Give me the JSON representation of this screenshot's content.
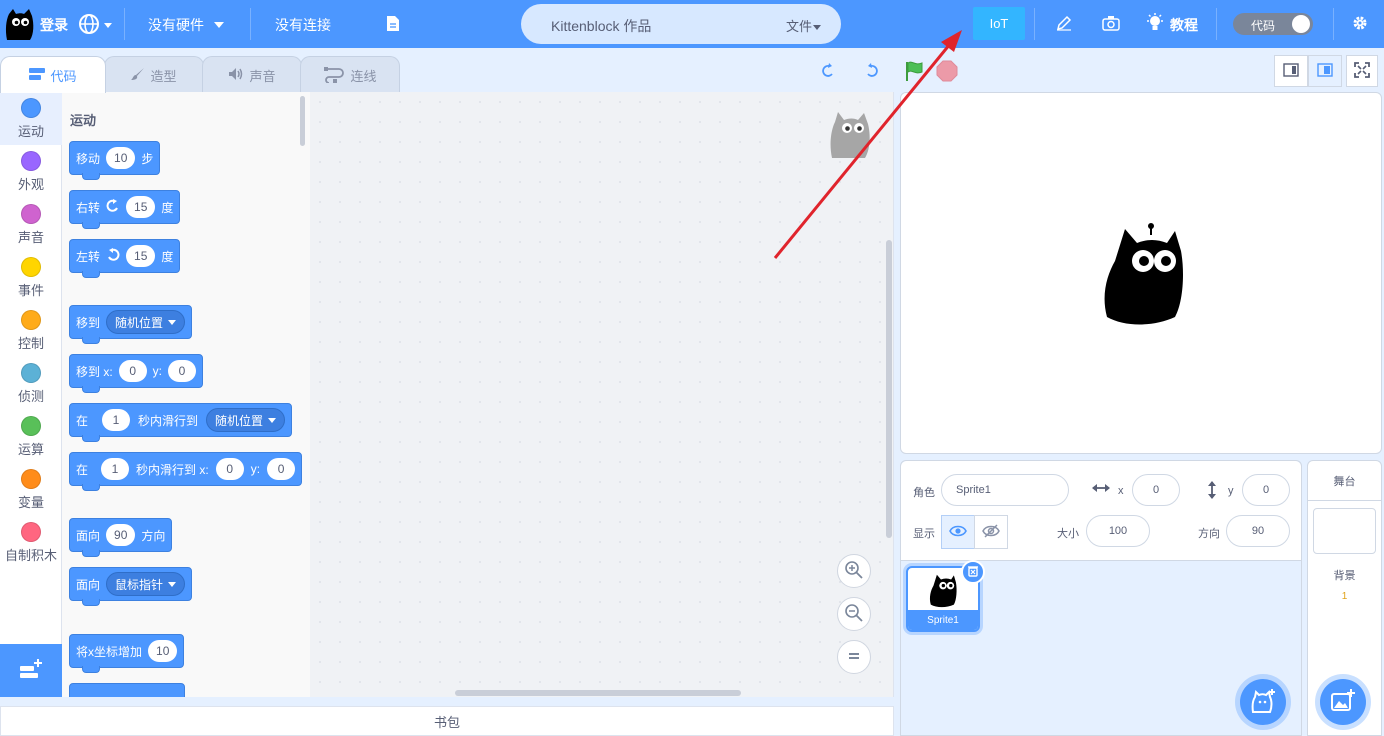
{
  "topbar": {
    "login": "登录",
    "hardware": "没有硬件",
    "connection": "没有连接",
    "project_title": "Kittenblock 作品",
    "file_menu": "文件",
    "iot": "IoT",
    "tutorial": "教程",
    "code_toggle": "代码"
  },
  "tabs": [
    {
      "label": "代码"
    },
    {
      "label": "造型"
    },
    {
      "label": "声音"
    },
    {
      "label": "连线"
    }
  ],
  "categories": [
    {
      "label": "运动",
      "color": "#4c97ff"
    },
    {
      "label": "外观",
      "color": "#9966ff"
    },
    {
      "label": "声音",
      "color": "#cf63cf"
    },
    {
      "label": "事件",
      "color": "#ffd500"
    },
    {
      "label": "控制",
      "color": "#ffab19"
    },
    {
      "label": "侦测",
      "color": "#5cb1d6"
    },
    {
      "label": "运算",
      "color": "#59c059"
    },
    {
      "label": "变量",
      "color": "#ff8c1a"
    },
    {
      "label": "自制积木",
      "color": "#ff6680"
    }
  ],
  "palette": {
    "title": "运动",
    "move": {
      "t1": "移动",
      "v1": "10",
      "t2": "步"
    },
    "turn_right": {
      "t1": "右转",
      "v1": "15",
      "t2": "度"
    },
    "turn_left": {
      "t1": "左转",
      "v1": "15",
      "t2": "度"
    },
    "goto": {
      "t1": "移到",
      "d1": "随机位置"
    },
    "goto_xy": {
      "t1": "移到 x:",
      "v1": "0",
      "t2": "y:",
      "v2": "0"
    },
    "glide": {
      "t1": "在",
      "v1": "1",
      "t2": "秒内滑行到",
      "d1": "随机位置"
    },
    "glide_xy": {
      "t1": "在",
      "v1": "1",
      "t2": "秒内滑行到 x:",
      "v2": "0",
      "t3": "y:",
      "v3": "0"
    },
    "point_dir": {
      "t1": "面向",
      "v1": "90",
      "t2": "方向"
    },
    "point_towards": {
      "t1": "面向",
      "d1": "鼠标指针"
    },
    "change_x": {
      "t1": "将x坐标增加",
      "v1": "10"
    }
  },
  "backpack": "书包",
  "sprite_info": {
    "sprite_label": "角色",
    "sprite_name": "Sprite1",
    "x_label": "x",
    "x_value": "0",
    "y_label": "y",
    "y_value": "0",
    "show_label": "显示",
    "size_label": "大小",
    "size_value": "100",
    "direction_label": "方向",
    "direction_value": "90"
  },
  "sprite_list": [
    {
      "name": "Sprite1"
    }
  ],
  "stage_selector": {
    "title": "舞台",
    "backdrops_label": "背景",
    "backdrops_count": "1"
  }
}
